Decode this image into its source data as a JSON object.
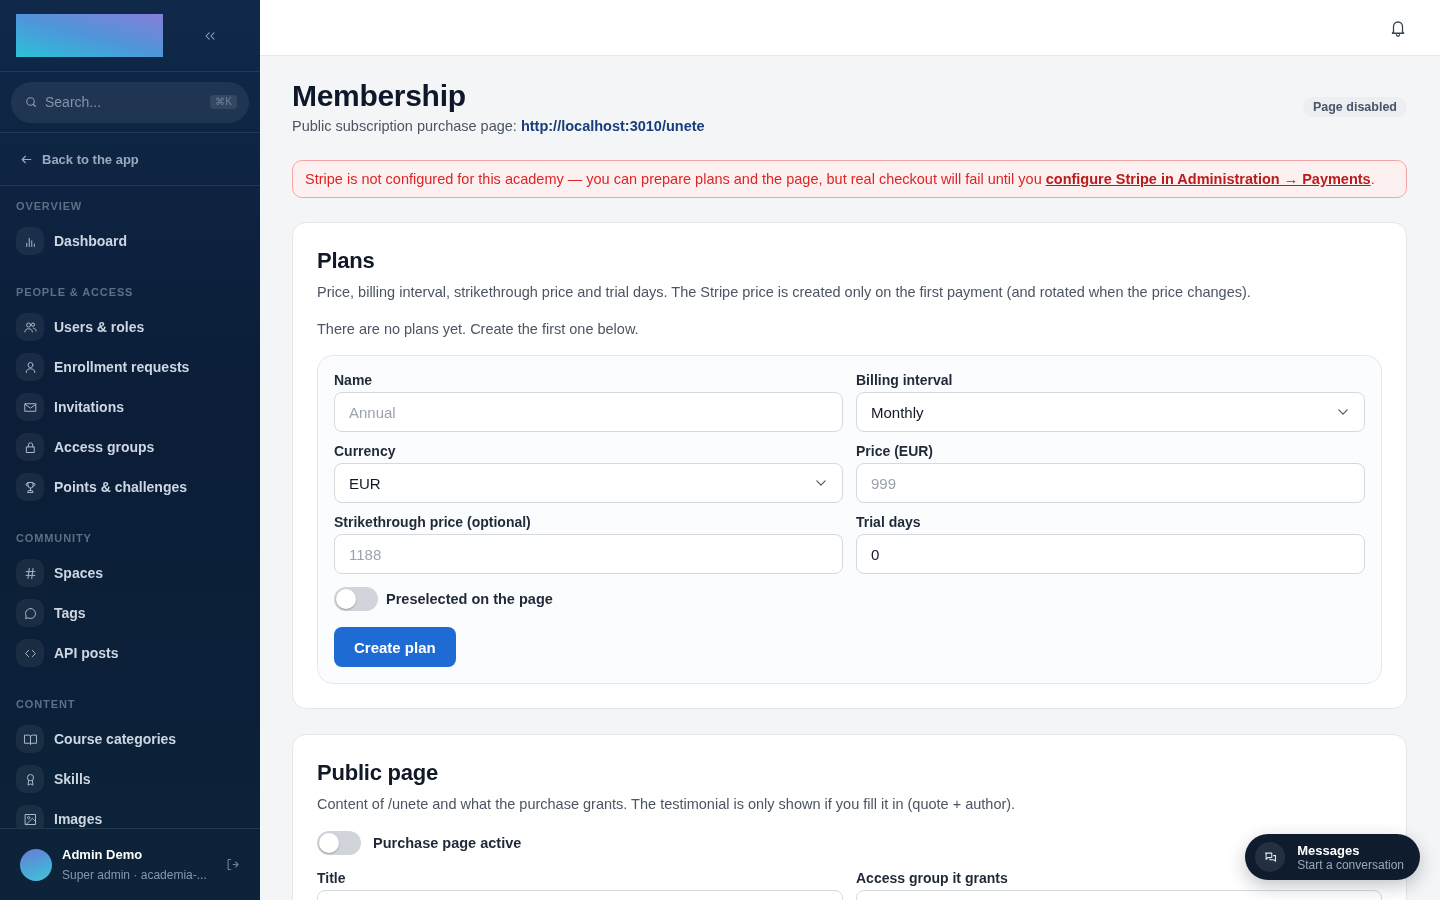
{
  "sidebar": {
    "search": {
      "placeholder": "Search...",
      "shortcut": "⌘K"
    },
    "back_link": "Back to the app",
    "sections": [
      {
        "title": "OVERVIEW",
        "items": [
          {
            "label": "Dashboard",
            "selected": false
          }
        ]
      },
      {
        "title": "PEOPLE & ACCESS",
        "items": [
          {
            "label": "Users & roles",
            "selected": false
          },
          {
            "label": "Enrollment requests",
            "selected": false
          },
          {
            "label": "Invitations",
            "selected": false
          },
          {
            "label": "Access groups",
            "selected": false
          },
          {
            "label": "Points & challenges",
            "selected": false
          }
        ]
      },
      {
        "title": "COMMUNITY",
        "items": [
          {
            "label": "Spaces",
            "selected": false
          },
          {
            "label": "Tags",
            "selected": false
          },
          {
            "label": "API posts",
            "selected": false
          }
        ]
      },
      {
        "title": "CONTENT",
        "items": [
          {
            "label": "Course categories",
            "selected": false
          },
          {
            "label": "Skills",
            "selected": false
          },
          {
            "label": "Images",
            "selected": false
          }
        ]
      }
    ],
    "user": {
      "name": "Admin Demo",
      "role": "Super admin · academia-..."
    }
  },
  "page": {
    "title": "Membership",
    "subtitle": "Public subscription purchase page:",
    "url": "http://localhost:3010/unete",
    "status_badge": "Page disabled"
  },
  "alert": {
    "text": "Stripe is not configured for this academy — you can prepare plans and the page, but real checkout will fail until you",
    "link": "configure Stripe in Administration → Payments",
    "end": "."
  },
  "plans": {
    "title": "Plans",
    "description": "Price, billing interval, strikethrough price and trial days. The Stripe price is created only on the first payment (and rotated when the price changes).",
    "empty_message": "There are no plans yet. Create the first one below.",
    "fields": [
      {
        "label": "Name",
        "kind": "text",
        "placeholder": "Annual"
      },
      {
        "label": "Billing interval",
        "kind": "select",
        "value": "Monthly"
      },
      {
        "label": "Currency",
        "kind": "select",
        "value": "EUR"
      },
      {
        "label": "Price (EUR)",
        "kind": "text",
        "placeholder": "999"
      },
      {
        "label": "Strikethrough price (optional)",
        "kind": "text",
        "placeholder": "1188"
      },
      {
        "label": "Trial days",
        "kind": "text",
        "value": "0"
      }
    ],
    "toggle": {
      "label": "Preselected on the page",
      "on": false
    },
    "submit": "Create plan"
  },
  "public_page": {
    "title": "Public page",
    "description": "Content of /unete and what the purchase grants. The testimonial is only shown if you fill it in (quote + author).",
    "toggle": {
      "label": "Purchase page active",
      "on": false
    },
    "fields": [
      {
        "label": "Title",
        "kind": "text"
      },
      {
        "label": "Access group it grants",
        "kind": "text"
      }
    ]
  },
  "messages": {
    "title": "Messages",
    "subtitle": "Start a conversation"
  }
}
